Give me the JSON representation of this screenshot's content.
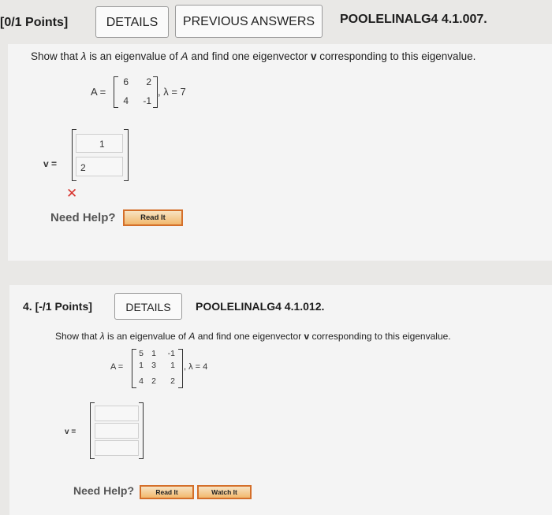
{
  "q3": {
    "points": "[0/1 Points]",
    "details": "DETAILS",
    "previous": "PREVIOUS ANSWERS",
    "code": "POOLELINALG4 4.1.007.",
    "prompt": {
      "p1": "Show that ",
      "lambda": "λ",
      "p2": " is an eigenvalue of ",
      "A": "A",
      "p3": " and find one eigenvector ",
      "v": "v",
      "p4": " corresponding to this eigenvalue."
    },
    "matrix_label": "A =",
    "matrix": [
      [
        "6",
        "2"
      ],
      [
        "4",
        "-1"
      ]
    ],
    "lambda_eq": ", λ = 7",
    "v_label": "v  =",
    "answers": [
      "1",
      "2"
    ],
    "wrong_mark": "✕",
    "need_help": "Need Help?",
    "read_it": "Read It"
  },
  "q4": {
    "points": "4.  [-/1 Points]",
    "details": "DETAILS",
    "code": "POOLELINALG4 4.1.012.",
    "prompt": {
      "p1": "Show that ",
      "lambda": "λ",
      "p2": " is an eigenvalue of ",
      "A": "A",
      "p3": " and find one eigenvector ",
      "v": "v",
      "p4": " corresponding to this eigenvalue."
    },
    "matrix_label": "A =",
    "matrix": [
      [
        "5",
        "1",
        "-1"
      ],
      [
        "1",
        "3",
        "1"
      ],
      [
        "4",
        "2",
        "2"
      ]
    ],
    "lambda_eq": ", λ = 4",
    "v_label": "v =",
    "answers": [
      "",
      "",
      ""
    ],
    "need_help": "Need Help?",
    "read_it": "Read It",
    "watch_it": "Watch It"
  },
  "colors": {
    "accent_red": "#d8322c",
    "button_border": "#d46f2a"
  }
}
